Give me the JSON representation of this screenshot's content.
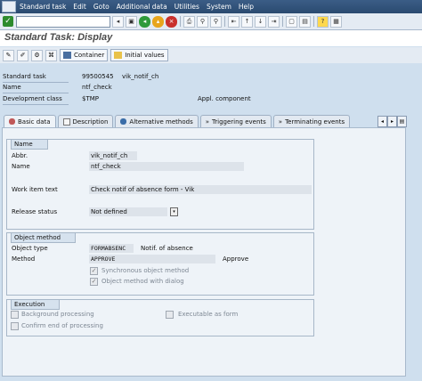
{
  "menubar": {
    "items": [
      "Standard task",
      "Edit",
      "Goto",
      "Additional data",
      "Utilities",
      "System",
      "Help"
    ]
  },
  "toolbar": {
    "command_field": "",
    "icons": [
      "enter-icon",
      "save-icon",
      "back-icon",
      "exit-icon",
      "cancel-icon",
      "print-icon",
      "find-icon",
      "find-next-icon",
      "first-page-icon",
      "prev-page-icon",
      "next-page-icon",
      "last-page-icon",
      "new-session-icon",
      "shortcut-icon",
      "help-icon",
      "layout-icon"
    ]
  },
  "screen": {
    "title": "Standard Task: Display"
  },
  "app_toolbar": {
    "container_label": "Container",
    "initial_values_label": "Initial values"
  },
  "header": {
    "standard_task_label": "Standard task",
    "standard_task_id": "99500545",
    "standard_task_abbr": "vik_notif_ch",
    "name_label": "Name",
    "name_value": "ntf_check",
    "dev_class_label": "Development class",
    "dev_class_value": "$TMP",
    "appl_component_label": "Appl. component"
  },
  "tabs": [
    {
      "label": "Basic data",
      "active": true
    },
    {
      "label": "Description",
      "active": false
    },
    {
      "label": "Alternative methods",
      "active": false
    },
    {
      "label": "Triggering events",
      "active": false
    },
    {
      "label": "Terminating events",
      "active": false
    }
  ],
  "name_group": {
    "title": "Name",
    "abbr_label": "Abbr.",
    "abbr_value": "vik_notif_ch",
    "name_label": "Name",
    "name_value": "ntf_check",
    "work_item_label": "Work item text",
    "work_item_value": "Check notif of absence form - Vik",
    "release_label": "Release status",
    "release_value": "Not defined"
  },
  "object_method_group": {
    "title": "Object method",
    "object_type_label": "Object type",
    "object_type_value": "FORMABSENC",
    "object_type_desc": "Notif. of absence",
    "method_label": "Method",
    "method_value": "APPROVE",
    "method_desc": "Approve",
    "sync_label": "Synchronous object method",
    "sync_checked": true,
    "dialog_label": "Object method with dialog",
    "dialog_checked": true
  },
  "execution_group": {
    "title": "Execution",
    "background_label": "Background processing",
    "background_checked": false,
    "executable_label": "Executable as form",
    "executable_checked": false,
    "confirm_label": "Confirm end of processing",
    "confirm_checked": false
  },
  "colors": {
    "menubar": "#2f5078",
    "background": "#cfdfee",
    "panel": "#eef3f8",
    "field": "#dde3ea"
  }
}
